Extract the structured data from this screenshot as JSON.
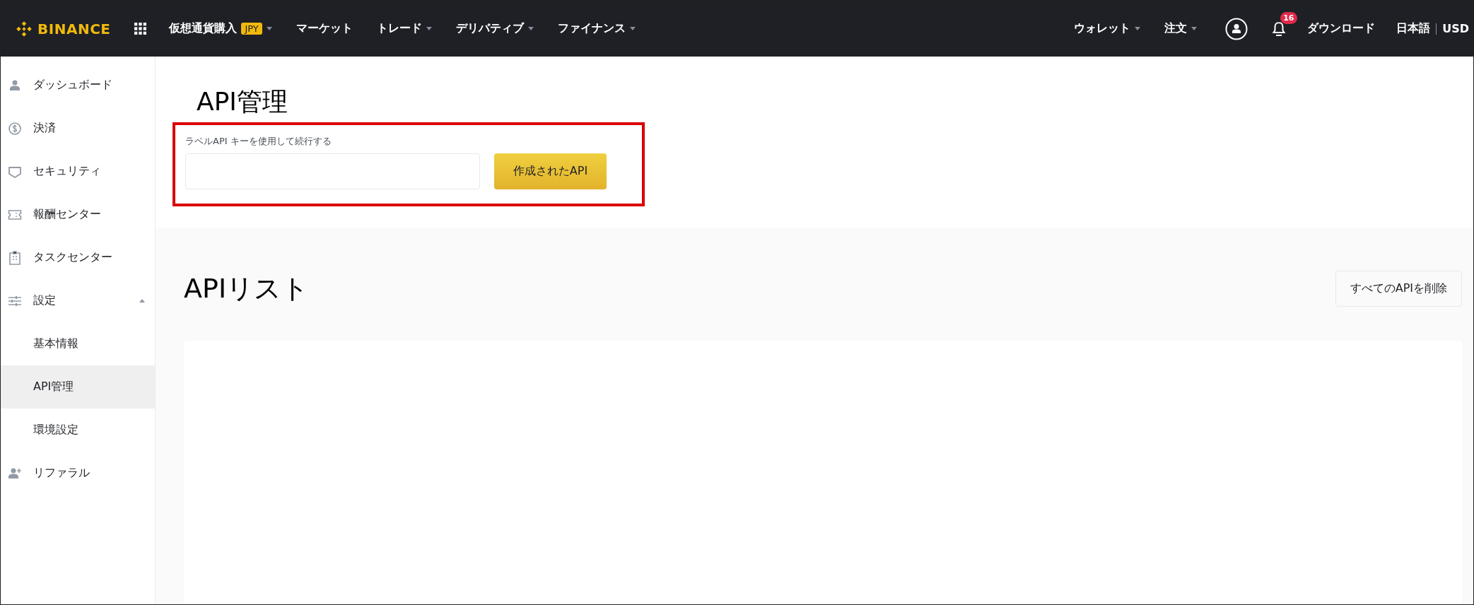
{
  "header": {
    "logo": "BINANCE",
    "nav": [
      {
        "label": "仮想通貨購入",
        "badge": "JPY",
        "dropdown": true
      },
      {
        "label": "マーケット",
        "dropdown": false
      },
      {
        "label": "トレード",
        "dropdown": true
      },
      {
        "label": "デリバティブ",
        "dropdown": true
      },
      {
        "label": "ファイナンス",
        "dropdown": true
      }
    ],
    "right_nav": [
      {
        "label": "ウォレット",
        "dropdown": true
      },
      {
        "label": "注文",
        "dropdown": true
      }
    ],
    "notification_count": "16",
    "download": "ダウンロード",
    "language": "日本語",
    "currency": "USD"
  },
  "sidebar": {
    "items": [
      {
        "label": "ダッシュボード",
        "selected": false
      },
      {
        "label": "決済",
        "selected": false
      },
      {
        "label": "セキュリティ",
        "selected": false
      },
      {
        "label": "報酬センター",
        "selected": false
      },
      {
        "label": "タスクセンター",
        "selected": false
      },
      {
        "label": "設定",
        "selected": false,
        "expanded": true,
        "children": [
          {
            "label": "基本情報",
            "selected": false
          },
          {
            "label": "API管理",
            "selected": true
          },
          {
            "label": "環境設定",
            "selected": false
          }
        ]
      },
      {
        "label": "リファラル",
        "selected": false
      }
    ]
  },
  "page": {
    "title": "API管理",
    "form": {
      "label": "ラベルAPI キーを使用して続行する",
      "button": "作成されたAPI"
    }
  },
  "api_list": {
    "title": "APIリスト",
    "delete_all_button": "すべてのAPIを削除"
  }
}
